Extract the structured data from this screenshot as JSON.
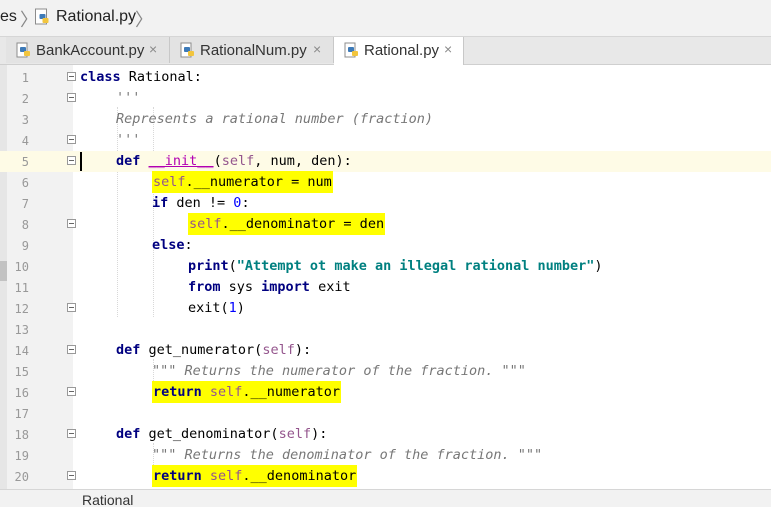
{
  "breadcrumb": {
    "prefix": "es",
    "file": "Rational.py"
  },
  "tabs": [
    {
      "label": "BankAccount.py",
      "active": false
    },
    {
      "label": "RationalNum.py",
      "active": false
    },
    {
      "label": "Rational.py",
      "active": true
    }
  ],
  "tab_close_glyph": "×",
  "current_line": 5,
  "lines": [
    {
      "n": "1"
    },
    {
      "n": "2"
    },
    {
      "n": "3"
    },
    {
      "n": "4"
    },
    {
      "n": "5"
    },
    {
      "n": "6"
    },
    {
      "n": "7"
    },
    {
      "n": "8"
    },
    {
      "n": "9"
    },
    {
      "n": "10"
    },
    {
      "n": "11"
    },
    {
      "n": "12"
    },
    {
      "n": "13"
    },
    {
      "n": "14"
    },
    {
      "n": "15"
    },
    {
      "n": "16"
    },
    {
      "n": "17"
    },
    {
      "n": "18"
    },
    {
      "n": "19"
    },
    {
      "n": "20"
    }
  ],
  "code": {
    "l1_kw": "class",
    "l1_name": " Rational:",
    "l2": "'''",
    "l3": "Represents a rational number (fraction)",
    "l4": "'''",
    "l5_def": "def",
    "l5_name": "__init__",
    "l5_rest_a": "(",
    "l5_self": "self",
    "l5_rest_b": ", num, den):",
    "l6_self": "self",
    "l6_rest": ".__numerator = num",
    "l7_if": "if",
    "l7_rest": " den != ",
    "l7_num": "0",
    "l7_end": ":",
    "l8_self": "self",
    "l8_rest": ".__denominator = den",
    "l9_else": "else",
    "l9_end": ":",
    "l10_fn": "print",
    "l10_open": "(",
    "l10_str": "\"Attempt ot make an illegal rational number\"",
    "l10_close": ")",
    "l11_from": "from",
    "l11_mid": " sys ",
    "l11_import": "import",
    "l11_end": " exit",
    "l12_fn": "exit",
    "l12_open": "(",
    "l12_num": "1",
    "l12_close": ")",
    "l14_def": "def",
    "l14_name": " get_numerator(",
    "l14_self": "self",
    "l14_end": "):",
    "l15": "\"\"\" Returns the numerator of the fraction. \"\"\"",
    "l16_ret": "return",
    "l16_self": " self",
    "l16_rest": ".__numerator",
    "l18_def": "def",
    "l18_name": " get_denominator(",
    "l18_self": "self",
    "l18_end": "):",
    "l19": "\"\"\" Returns the denominator of the fraction. \"\"\"",
    "l20_ret": "return",
    "l20_self": " self",
    "l20_rest": ".__denominator"
  },
  "status": {
    "text": "Rational"
  },
  "colors": {
    "highlight": "#ffff00",
    "keyword": "#000080",
    "string": "#008080",
    "self": "#94558d",
    "number": "#0000ff",
    "docstring": "#777777"
  }
}
